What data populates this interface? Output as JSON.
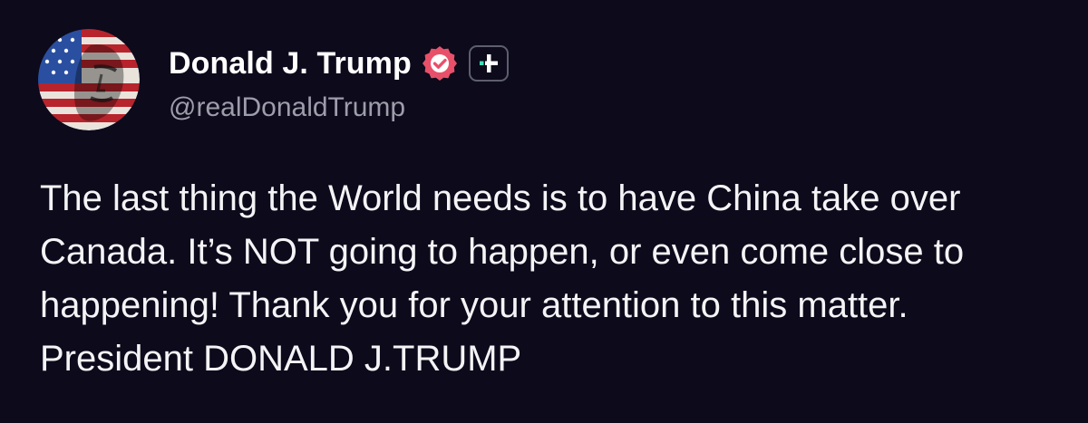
{
  "post": {
    "author": {
      "display_name": "Donald J. Trump",
      "handle": "@realDonaldTrump",
      "avatar_icon": "flag-portrait-avatar",
      "verified_icon": "verified-check-icon",
      "follow_icon": "plus-icon"
    },
    "text": "The last thing the World needs is to have China take over Canada. It’s NOT going to happen, or even come close to happening! Thank you for your attention to this matter. President DONALD J.TRUMP"
  },
  "colors": {
    "background": "#0c0a1b",
    "text": "#f4f4f6",
    "handle": "#9e9dab",
    "verified_badge": "#e8506a",
    "plus_accent": "#3fe0b8"
  }
}
